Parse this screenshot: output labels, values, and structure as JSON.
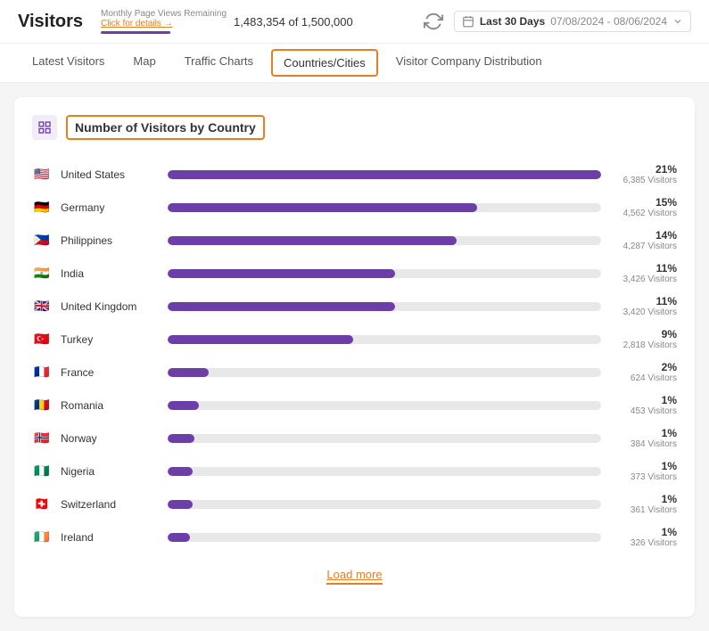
{
  "header": {
    "title": "Visitors",
    "quota_label": "Monthly Page Views Remaining",
    "quota_link": "Click for details →",
    "quota_value": "1,483,354 of 1,500,000"
  },
  "date_range": {
    "label": "Last 30 Days",
    "value": "07/08/2024 - 08/06/2024"
  },
  "nav_tabs": [
    {
      "label": "Latest Visitors",
      "active": false
    },
    {
      "label": "Map",
      "active": false
    },
    {
      "label": "Traffic Charts",
      "active": false
    },
    {
      "label": "Countries/Cities",
      "active": true
    },
    {
      "label": "Visitor Company Distribution",
      "active": false
    }
  ],
  "card": {
    "title": "Number of Visitors by Country",
    "icon": "📊"
  },
  "countries": [
    {
      "name": "United States",
      "flag": "🇺🇸",
      "pct": 21,
      "pct_label": "21%",
      "visitors": "6,385 Visitors"
    },
    {
      "name": "Germany",
      "flag": "🇩🇪",
      "pct": 15,
      "pct_label": "15%",
      "visitors": "4,562 Visitors"
    },
    {
      "name": "Philippines",
      "flag": "🇵🇭",
      "pct": 14,
      "pct_label": "14%",
      "visitors": "4,287 Visitors"
    },
    {
      "name": "India",
      "flag": "🇮🇳",
      "pct": 11,
      "pct_label": "11%",
      "visitors": "3,426 Visitors"
    },
    {
      "name": "United Kingdom",
      "flag": "🇬🇧",
      "pct": 11,
      "pct_label": "11%",
      "visitors": "3,420 Visitors"
    },
    {
      "name": "Turkey",
      "flag": "🇹🇷",
      "pct": 9,
      "pct_label": "9%",
      "visitors": "2,818 Visitors"
    },
    {
      "name": "France",
      "flag": "🇫🇷",
      "pct": 2,
      "pct_label": "2%",
      "visitors": "624 Visitors"
    },
    {
      "name": "Romania",
      "flag": "🇷🇴",
      "pct": 1.5,
      "pct_label": "1%",
      "visitors": "453 Visitors"
    },
    {
      "name": "Norway",
      "flag": "🇳🇴",
      "pct": 1.3,
      "pct_label": "1%",
      "visitors": "384 Visitors"
    },
    {
      "name": "Nigeria",
      "flag": "🇳🇬",
      "pct": 1.2,
      "pct_label": "1%",
      "visitors": "373 Visitors"
    },
    {
      "name": "Switzerland",
      "flag": "🇨🇭",
      "pct": 1.2,
      "pct_label": "1%",
      "visitors": "361 Visitors"
    },
    {
      "name": "Ireland",
      "flag": "🇮🇪",
      "pct": 1.1,
      "pct_label": "1%",
      "visitors": "326 Visitors"
    }
  ],
  "load_more_label": "Load more"
}
